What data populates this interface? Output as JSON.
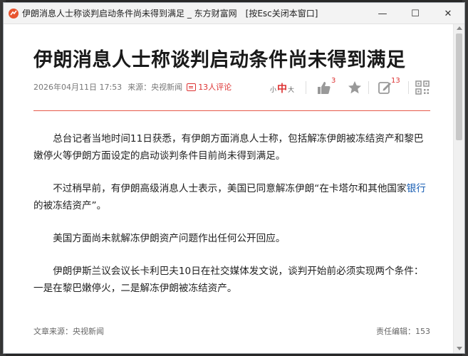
{
  "window": {
    "title": "伊朗消息人士称谈判启动条件尚未得到满足 _ 东方财富网　[按Esc关闭本窗口]",
    "minimize_glyph": "—",
    "maximize_glyph": "☐",
    "close_glyph": "✕"
  },
  "article": {
    "headline": "伊朗消息人士称谈判启动条件尚未得到满足",
    "datetime": "2026年04月11日 17:53",
    "source": "来源：央视新闻",
    "comments": "13人评论",
    "paragraphs": {
      "p1": "总台记者当地时间11日获悉，有伊朗方面消息人士称，包括解冻伊朗被冻结资产和黎巴嫩停火等伊朗方面设定的启动谈判条件目前尚未得到满足。",
      "p2_before": "不过稍早前，有伊朗高级消息人士表示，美国已同意解冻伊朗“在卡塔尔和其他国家",
      "p2_link": "银行",
      "p2_after": "的被冻结资产”。",
      "p3": "美国方面尚未就解冻伊朗资产问题作出任何公开回应。",
      "p4": "伊朗伊斯兰议会议长卡利巴夫10日在社交媒体发文说，谈判开始前必须实现两个条件：一是在黎巴嫩停火，二是解冻伊朗被冻结资产。"
    },
    "footer_source": "文章来源：央视新闻",
    "footer_editor": "责任编辑：153"
  },
  "toolbar": {
    "font_small": "小",
    "font_mid": "中",
    "font_large": "大",
    "like_count": "3",
    "edit_count": "13"
  },
  "colors": {
    "accent_red": "#d33333",
    "rule_red": "#e65a4a",
    "link_blue": "#1a5fb4"
  },
  "icons": [
    "app-logo-icon",
    "comment-icon",
    "like-icon",
    "star-icon",
    "edit-icon",
    "qr-code-icon"
  ]
}
